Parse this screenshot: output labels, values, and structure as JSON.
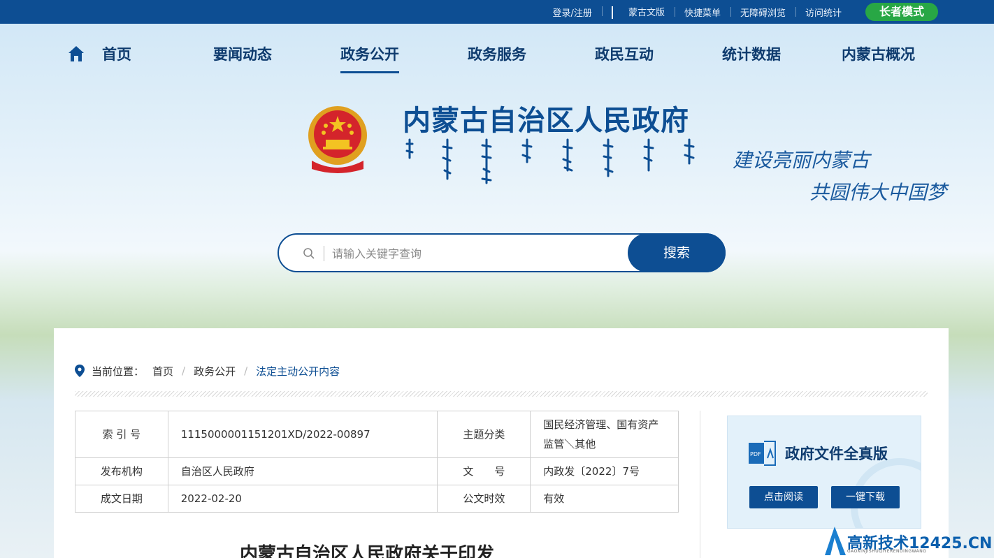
{
  "topbar": {
    "links": [
      "登录/注册",
      "蒙古文版",
      "快捷菜单",
      "无障碍浏览",
      "访问统计"
    ],
    "elder_mode": "长者模式"
  },
  "nav": {
    "items": [
      "首页",
      "要闻动态",
      "政务公开",
      "政务服务",
      "政民互动",
      "统计数据",
      "内蒙古概况"
    ],
    "active": "政务公开"
  },
  "header": {
    "title": "内蒙古自治区人民政府",
    "slogan_line1": "建设亮丽内蒙古",
    "slogan_line2": "共圆伟大中国梦"
  },
  "search": {
    "placeholder": "请输入关键字查询",
    "button": "搜索"
  },
  "breadcrumb": {
    "label": "当前位置：",
    "items": [
      "首页",
      "政务公开",
      "法定主动公开内容"
    ]
  },
  "meta_table": {
    "rows": [
      {
        "label1": "索 引 号",
        "value1": "1115000001151201XD/2022-00897",
        "label2": "主题分类",
        "value2": "国民经济管理、国有资产监管＼其他"
      },
      {
        "label1": "发布机构",
        "value1": "自治区人民政府",
        "label2": "文　　号",
        "value2": "内政发〔2022〕7号"
      },
      {
        "label1": "成文日期",
        "value1": "2022-02-20",
        "label2": "公文时效",
        "value2": "有效"
      }
    ]
  },
  "doc_card": {
    "title": "政府文件全真版",
    "read_button": "点击阅读",
    "download_button": "一键下载"
  },
  "article": {
    "title": "内蒙古自治区人民政府关于印发"
  },
  "watermark": {
    "text": "高新技术12425.CN",
    "sub": "GAOXINJISHUQIYERENDINGWANG"
  },
  "colors": {
    "primary": "#0d4e93",
    "nav_text": "#0e3b6e",
    "elder_green": "#28a745"
  }
}
